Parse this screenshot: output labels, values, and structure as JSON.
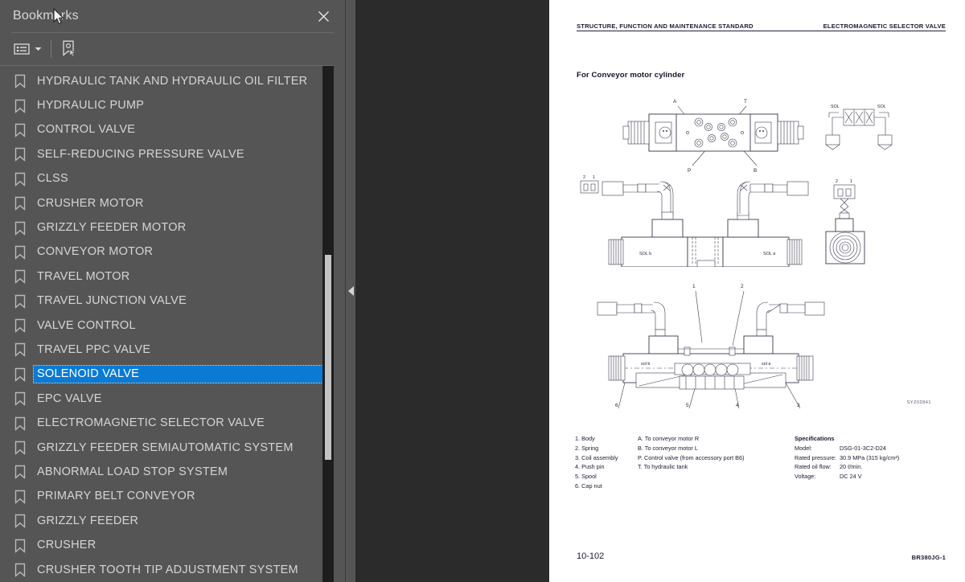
{
  "sidebar": {
    "title": "Bookmarks",
    "close_icon": "close-icon",
    "toolbar": {
      "list_options_label": "list-options-icon",
      "caret_label": "chevron-down-icon",
      "new_bookmark_label": "new-bookmark-icon"
    },
    "selected_bookmark": "SOLENOID VALVE",
    "selection_color": "#0a7bd4",
    "items": [
      {
        "label": "HYDRAULIC TANK AND HYDRAULIC OIL FILTER",
        "selected": false
      },
      {
        "label": "HYDRAULIC PUMP",
        "selected": false
      },
      {
        "label": "CONTROL VALVE",
        "selected": false
      },
      {
        "label": "SELF-REDUCING PRESSURE VALVE",
        "selected": false
      },
      {
        "label": "CLSS",
        "selected": false
      },
      {
        "label": "CRUSHER MOTOR",
        "selected": false
      },
      {
        "label": "GRIZZLY FEEDER MOTOR",
        "selected": false
      },
      {
        "label": "CONVEYOR MOTOR",
        "selected": false
      },
      {
        "label": "TRAVEL MOTOR",
        "selected": false
      },
      {
        "label": "TRAVEL JUNCTION VALVE",
        "selected": false
      },
      {
        "label": "VALVE CONTROL",
        "selected": false
      },
      {
        "label": "TRAVEL PPC VALVE",
        "selected": false
      },
      {
        "label": "SOLENOID VALVE",
        "selected": true
      },
      {
        "label": "EPC VALVE",
        "selected": false
      },
      {
        "label": "ELECTROMAGNETIC SELECTOR VALVE",
        "selected": false
      },
      {
        "label": "GRIZZLY FEEDER SEMIAUTOMATIC SYSTEM",
        "selected": false
      },
      {
        "label": "ABNORMAL LOAD STOP SYSTEM",
        "selected": false
      },
      {
        "label": "PRIMARY BELT CONVEYOR",
        "selected": false
      },
      {
        "label": "GRIZZLY FEEDER",
        "selected": false
      },
      {
        "label": "CRUSHER",
        "selected": false
      },
      {
        "label": "CRUSHER TOOTH TIP ADJUSTMENT SYSTEM",
        "selected": false
      }
    ]
  },
  "splitter": {
    "collapse_icon": "chevron-left-icon"
  },
  "page": {
    "header_left": "STRUCTURE, FUNCTION AND MAINTENANCE STANDARD",
    "header_right": "ELECTROMAGNETIC SELECTOR VALVE",
    "subtitle": "For Conveyor motor cylinder",
    "figure_code": "SYZ02841",
    "footer_left": "10-102",
    "footer_right": "BR380JG-1",
    "diagram_labels": {
      "top_view": [
        "A",
        "T",
        "P",
        "B"
      ],
      "side_view": [
        "SOL b",
        "SOL a",
        "2",
        "1"
      ],
      "section_view": [
        "1",
        "2",
        "3",
        "4",
        "5",
        "6",
        "sol b",
        "sol a"
      ]
    },
    "legend_parts": [
      "1. Body",
      "2. Spring",
      "3. Coil assembly",
      "4. Push pin",
      "5. Spool",
      "6. Cap nut"
    ],
    "legend_ports": [
      "A. To conveyor motor R",
      "B. To conveyor motor L",
      "P. Control valve (from accessory port B6)",
      "T. To hydraulic tank"
    ],
    "specifications": {
      "heading": "Specifications",
      "rows": [
        {
          "key": "Model:",
          "value": "DSG-01-3C2-D24"
        },
        {
          "key": "Rated pressure:",
          "value": "30.9 MPa (315 kg/cm²)"
        },
        {
          "key": "Rated oil flow:",
          "value": "20 ℓ/min."
        },
        {
          "key": "Voltage:",
          "value": "DC 24 V"
        }
      ]
    }
  }
}
